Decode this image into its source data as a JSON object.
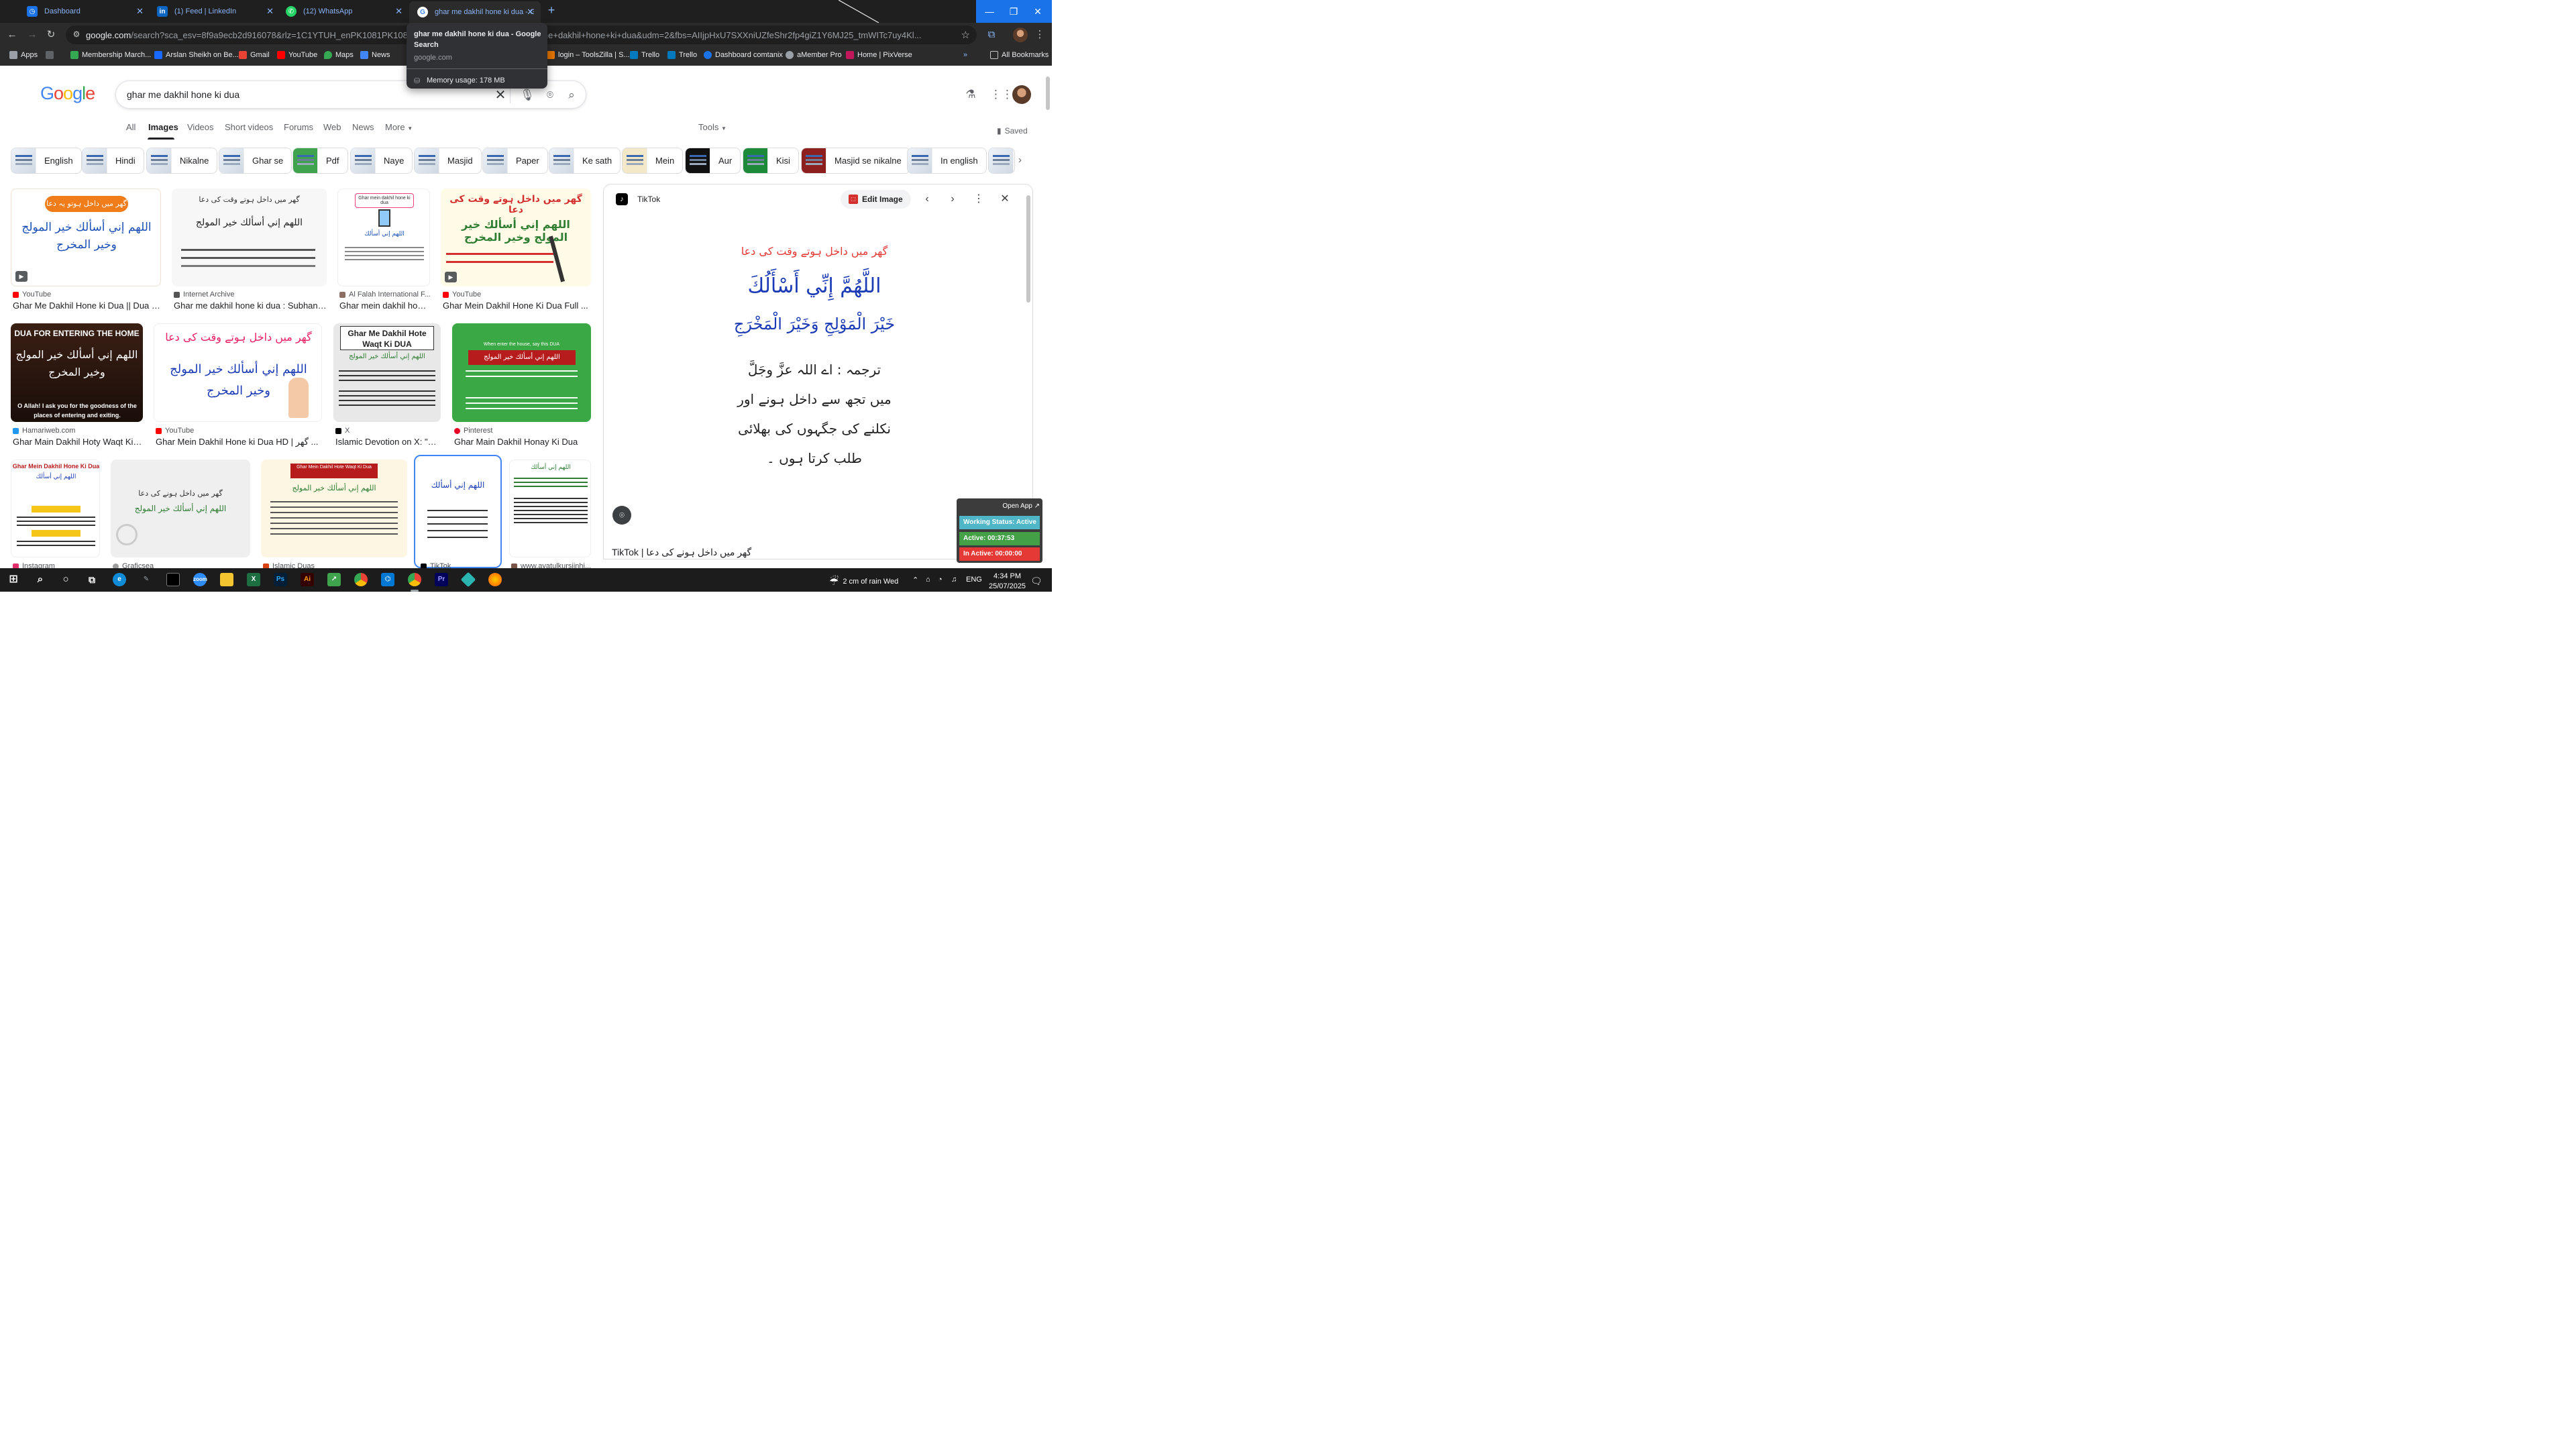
{
  "browser": {
    "tabs": [
      {
        "title": "Dashboard",
        "icon": "dashboard-icon"
      },
      {
        "title": "(1) Feed | LinkedIn",
        "icon": "linkedin-icon"
      },
      {
        "title": "(12) WhatsApp",
        "icon": "whatsapp-icon"
      },
      {
        "title": "ghar me dakhil hone ki dua - G",
        "icon": "google-icon"
      }
    ],
    "url_host": "google.com",
    "url_path": "/search?sca_esv=8f9a9ecb2d916078&rlz=1C1YTUH_enPK1081PK1081&sxsrf=AE3T",
    "url_tail": "42050695&q=ghar+me+dakhil+hone+ki+dua&udm=2&fbs=AIIjpHxU7SXXniUZfeShr2fp4giZ1Y6MJ25_tmWITc7uy4Kl...",
    "bookmarks": [
      "Apps",
      "Membership March...",
      "Arslan Sheikh on Be...",
      "Gmail",
      "YouTube",
      "Maps",
      "News",
      "login – ToolsZilla | S...",
      "Trello",
      "Trello",
      "Dashboard comtanix",
      "aMember Pro",
      "Home | PixVerse"
    ],
    "all_bookmarks": "All Bookmarks",
    "hovercard": {
      "title": "ghar me dakhil hone ki dua - Google Search",
      "domain": "google.com",
      "memory": "Memory usage: 178 MB"
    }
  },
  "search": {
    "logo": "Google",
    "query": "ghar me dakhil hone ki dua",
    "tabs": [
      "All",
      "Images",
      "Videos",
      "Short videos",
      "Forums",
      "Web",
      "News",
      "More"
    ],
    "active_tab": "Images",
    "tools": "Tools",
    "saved": "Saved",
    "chips": [
      "English",
      "Hindi",
      "Nikalne",
      "Ghar se",
      "Pdf",
      "Naye",
      "Masjid",
      "Paper",
      "Ke sath",
      "Mein",
      "Aur",
      "Kisi",
      "Masjid se nikalne",
      "In english"
    ]
  },
  "results": [
    {
      "source": "YouTube",
      "title": "Ghar Me Dakhil Hone ki Dua || Dua Wh...",
      "caption": "گھر میں داخل ہوتو یہ دعا پڑھے",
      "arabic": "اللهم إني أسألك خير المولج وخير المخرج"
    },
    {
      "source": "Internet Archive",
      "title": "Ghar me dakhil hone ki dua : Subhan ...",
      "caption": "گھر میں داخل ہوتے وقت کی دعا",
      "arabic": "اللهم إني أسألك خير المولج"
    },
    {
      "source": "Al Falah International F...",
      "title": "Ghar mein dakhil hone...",
      "caption": "Ghar mein dakhil hone ki dua",
      "arabic": "اللهم إني أسألك"
    },
    {
      "source": "YouTube",
      "title": "Ghar Mein Dakhil Hone Ki Dua Full ...",
      "caption": "گھر میں داخل ہوتے وقت کی دعا",
      "arabic": "اللهم إني أسألك خير المولج وخير المخرج"
    },
    {
      "source": "Hamariweb.com",
      "title": "Ghar Main Dakhil Hoty Waqt Ki D...",
      "caption": "DUA FOR ENTERING THE HOME",
      "arabic": "اللهم إني أسألك خير المولج وخير المخرج",
      "footer": "O Allah! I ask you for the goodness of the places of entering and exiting."
    },
    {
      "source": "YouTube",
      "title": "Ghar Mein Dakhil Hone ki Dua HD | گھر ...",
      "caption": "گھر میں داخل ہوتے وقت کی دعا",
      "arabic": "اللهم إني أسألك خير المولج وخير المخرج"
    },
    {
      "source": "X",
      "title": "Islamic Devotion on X: \"Gh...",
      "caption": "Ghar Me Dakhil Hote Waqt Ki DUA",
      "arabic": "اللهم إني أسألك خير المولج"
    },
    {
      "source": "Pinterest",
      "title": "Ghar Main Dakhil Honay Ki Dua",
      "caption": "When enter the house, say this DUA",
      "arabic": "اللهم إني أسألك خير المولج"
    },
    {
      "source": "Instagram",
      "title": "",
      "caption": "Ghar Mein Dakhil Hone Ki Dua",
      "arabic": "اللهم إني أسألك"
    },
    {
      "source": "Graficsea",
      "title": "",
      "caption": "گھر میں داخل ہونے کی دعا",
      "arabic": "اللهم إني أسألك خير المولج"
    },
    {
      "source": "Islamic Duas",
      "title": "",
      "caption": "Ghar Mein Dakhil Hote Waqt Ki Dua",
      "arabic": "اللهم إني أسألك خير المولج"
    },
    {
      "source": "TikTok",
      "title": "",
      "caption": "",
      "arabic": "اللهم إني أسألك"
    },
    {
      "source": "www.ayatulkursiinhi...",
      "title": "",
      "caption": "",
      "arabic": "اللهم إني أسألك"
    }
  ],
  "panel": {
    "source": "TikTok",
    "edit_label": "Edit Image",
    "image_heading": "گھر میں داخل ہوتے وقت کی دعا",
    "image_arabic_1": "اللَّهُمَّ إِنِّي أَسْأَلُكَ",
    "image_arabic_2": "خَيْرَ الْمَوْلِجِ وَخَيْرَ الْمَخْرَجِ",
    "image_urdu": "ترجمہ : اے اللہ عزَّ وجَلَّ میں تجھ سے داخل ہونے اور نکلنے کی جگہوں کی بھلائی طلب کرتا ہوں ۔",
    "caption": "TikTok | گھر میں داخل ہونے کی دعا"
  },
  "tracker": {
    "open_app": "Open App ↗",
    "working": "Working Status: Active",
    "active": "Active: 00:37:53",
    "inactive": "In Active: 00:00:00"
  },
  "taskbar": {
    "weather": "2 cm of rain Wed",
    "lang": "ENG",
    "time": "4:34 PM",
    "date": "25/07/2025"
  },
  "colors": {
    "chrome_bg": "#1f1f1f",
    "chrome_toolbar": "#2b2b2b",
    "link_blue": "#8ab4f8",
    "google_blue": "#4285f4",
    "google_red": "#ea4335",
    "google_yellow": "#fbbc05",
    "google_green": "#34a853"
  }
}
